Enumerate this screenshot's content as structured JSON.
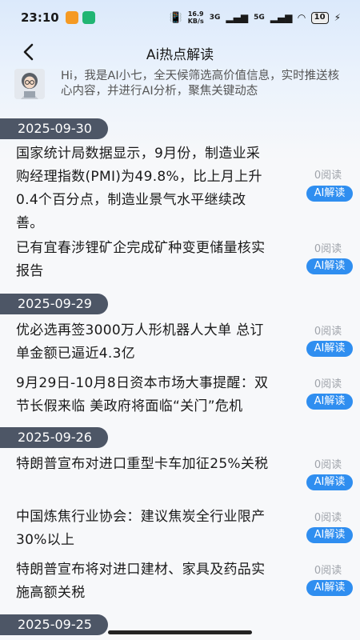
{
  "status": {
    "time": "23:10",
    "net_speed_value": "16.9",
    "net_speed_unit": "KB/s",
    "signal1": "3G",
    "signal2": "5G",
    "battery": "10"
  },
  "nav": {
    "title": "Ai热点解读"
  },
  "intro": {
    "text": "Hi，我是AI小七，全天候筛选高价值信息，实时推送核心内容，并进行AI分析，聚焦关键动态"
  },
  "sections": [
    {
      "date": "2025-09-30",
      "items": [
        {
          "title": "国家统计局数据显示，9月份，制造业采购经理指数(PMI)为49.8%，比上月上升0.4个百分点，制造业景气水平继续改善。",
          "reads": "0阅读",
          "ai": "AI解读"
        },
        {
          "title": "已有宜春涉锂矿企完成矿种变更储量核实报告",
          "reads": "0阅读",
          "ai": "AI解读"
        }
      ]
    },
    {
      "date": "2025-09-29",
      "items": [
        {
          "title": "优必选再签3000万人形机器人大单 总订单金额已逼近4.3亿",
          "reads": "0阅读",
          "ai": "AI解读"
        },
        {
          "title": "9月29日-10月8日资本市场大事提醒：双节长假来临 美政府将面临“关门”危机",
          "reads": "0阅读",
          "ai": "AI解读"
        }
      ]
    },
    {
      "date": "2025-09-26",
      "items": [
        {
          "title": "特朗普宣布对进口重型卡车加征25%关税",
          "reads": "0阅读",
          "ai": "AI解读"
        },
        {
          "title": "中国炼焦行业协会：建议焦炭全行业限产30%以上",
          "reads": "0阅读",
          "ai": "AI解读"
        },
        {
          "title": "特朗普宣布将对进口建材、家具及药品实施高额关税",
          "reads": "0阅读",
          "ai": "AI解读"
        }
      ]
    },
    {
      "date": "2025-09-25",
      "items": []
    }
  ],
  "colors": {
    "accent": "#2f8ef0",
    "date_badge": "#4d5666"
  }
}
